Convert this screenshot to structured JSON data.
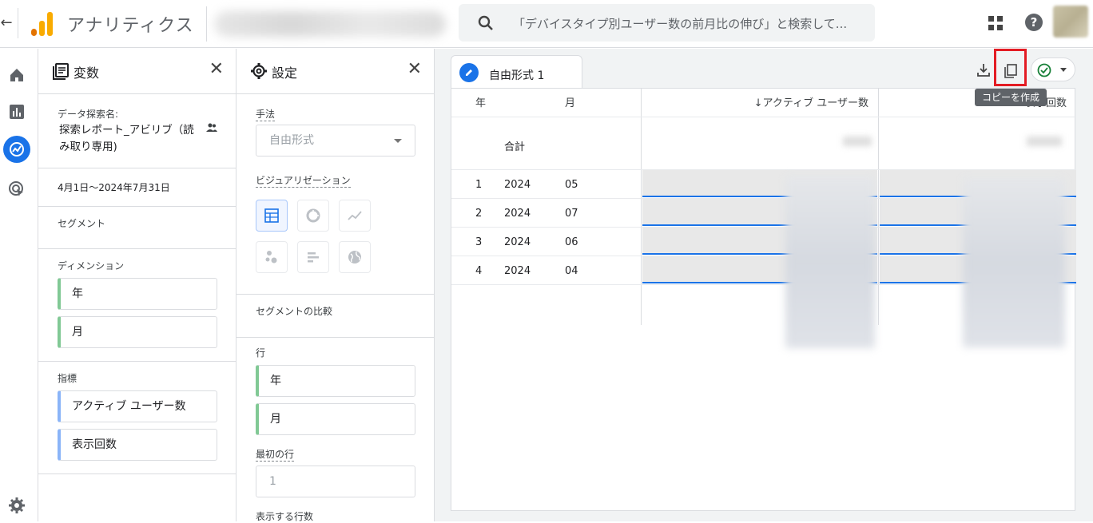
{
  "topbar": {
    "app_title": "アナリティクス",
    "search_placeholder": "「デバイスタイプ別ユーザー数の前月比の伸び」と検索して..."
  },
  "variables": {
    "title": "変数",
    "exploration_name_label": "データ探索名:",
    "exploration_name_line1": "探索レポート_アビリブ（読",
    "exploration_name_line2": "み取り専用)",
    "date_range": "4月1日～2024年7月31日",
    "segments_label": "セグメント",
    "dimensions_label": "ディメンション",
    "dimensions": [
      "年",
      "月"
    ],
    "metrics_label": "指標",
    "metrics": [
      "アクティブ ユーザー数",
      "表示回数"
    ]
  },
  "settings": {
    "title": "設定",
    "technique_label": "手法",
    "technique_value": "自由形式",
    "visualization_label": "ビジュアリゼーション",
    "segment_compare_label": "セグメントの比較",
    "rows_label": "行",
    "rows": [
      "年",
      "月"
    ],
    "first_row_label": "最初の行",
    "first_row_value": "1",
    "rows_shown_label": "表示する行数"
  },
  "canvas": {
    "tab_label": "自由形式 1",
    "tooltip": "コピーを作成",
    "table": {
      "headers": {
        "year": "年",
        "month": "月",
        "active_users": "↓アクティブ ユーザー数",
        "views": "表示回数"
      },
      "total_label": "合計",
      "rows": [
        {
          "index": "1",
          "year": "2024",
          "month": "05"
        },
        {
          "index": "2",
          "year": "2024",
          "month": "07"
        },
        {
          "index": "3",
          "year": "2024",
          "month": "06"
        },
        {
          "index": "4",
          "year": "2024",
          "month": "04"
        }
      ]
    }
  },
  "colors": {
    "accent": "#1a73e8",
    "highlight": "#e31b23",
    "dimension_chip": "#81c995",
    "metric_chip": "#8ab4f8"
  }
}
